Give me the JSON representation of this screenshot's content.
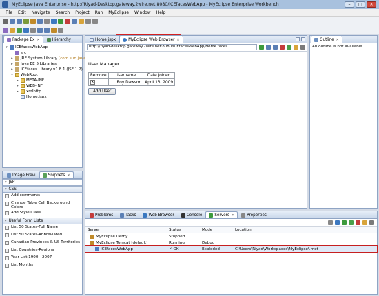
{
  "window": {
    "title": "MyEclipse Java Enterprise - http://Riyad-Desktop.gateway.2wire.net:8080/ICEfacesWebApp - MyEclipse Enterprise Workbench"
  },
  "menu": [
    "File",
    "Edit",
    "Navigate",
    "Search",
    "Project",
    "Run",
    "MyEclipse",
    "Window",
    "Help"
  ],
  "left_panel": {
    "tabs": [
      "Package Ex",
      "Hierarchy"
    ],
    "tree": [
      {
        "label": "ICEfacesWebApp",
        "depth": 0,
        "icon": "project",
        "arrow": "▾"
      },
      {
        "label": "src",
        "depth": 1,
        "icon": "package",
        "arrow": ""
      },
      {
        "label": "JRE System Library",
        "extra": "[com.sun.java",
        "depth": 1,
        "icon": "jar",
        "arrow": "▸"
      },
      {
        "label": "Java EE 5 Libraries",
        "depth": 1,
        "icon": "jar",
        "arrow": "▸"
      },
      {
        "label": "ICEfaces Library v1.8.1 (JSF 1.2)",
        "depth": 1,
        "icon": "jar",
        "arrow": "▸"
      },
      {
        "label": "WebRoot",
        "depth": 1,
        "icon": "folder",
        "arrow": "▾"
      },
      {
        "label": "META-INF",
        "depth": 2,
        "icon": "folder",
        "arrow": "▸"
      },
      {
        "label": "WEB-INF",
        "depth": 2,
        "icon": "folder",
        "arrow": "▸"
      },
      {
        "label": "xmlhttp",
        "depth": 2,
        "icon": "folder",
        "arrow": "▸"
      },
      {
        "label": "Home.jspx",
        "depth": 2,
        "icon": "file",
        "arrow": ""
      }
    ]
  },
  "snippets_panel": {
    "tabs": [
      "Image Previ",
      "Snippets"
    ],
    "dropdown": "JSP",
    "drawers": [
      {
        "label": "CSS",
        "items": [
          "Add comments",
          "Change Table Cell Background Colors",
          "Add Style Class"
        ]
      },
      {
        "label": "Useful Form Lists",
        "items": [
          "List 50 States-Full Name",
          "List 50 States-Abbreviated",
          "Canadian Provinces & US Territories",
          "List Countries-Regions",
          "Year List 1900 - 2007",
          "List Months"
        ]
      }
    ]
  },
  "editor": {
    "tabs": [
      "Home.jspx",
      "MyEclipse Web Browser"
    ],
    "url": "http://riyad-desktop.gateway.2wire.net:8080/ICEfacesWebApp/Home.faces",
    "page_title": "User Manager",
    "table": {
      "headers": [
        "Remove",
        "Username",
        "Date Joined"
      ],
      "rows": [
        [
          "x",
          "Roy Dawson",
          "April 13, 2009"
        ]
      ]
    },
    "add_button": "Add User"
  },
  "outline": {
    "tab": "Outline",
    "message": "An outline is not available."
  },
  "bottom_panel": {
    "tabs": [
      "Problems",
      "Tasks",
      "Web Browser",
      "Console",
      "Servers",
      "Properties"
    ],
    "headers": [
      "Server",
      "Status",
      "Mode",
      "Location"
    ],
    "rows": [
      {
        "server": "MyEclipse Derby",
        "status": "Stopped",
        "mode": "",
        "location": "",
        "indent": 1
      },
      {
        "server": "MyEclipse Tomcat  [default]",
        "status": "Running",
        "mode": "Debug",
        "location": "",
        "indent": 1
      },
      {
        "server": "ICEfacesWebApp",
        "status": "OK",
        "mode": "Exploded",
        "location": "C:\\Users\\Riyad\\Workspaces\\MyEclipse\\.met",
        "indent": 2
      }
    ]
  },
  "colors": {
    "highlight_box": "#d42020",
    "panel_border": "#8fa4c4",
    "title_bar": "#a8c1de"
  }
}
